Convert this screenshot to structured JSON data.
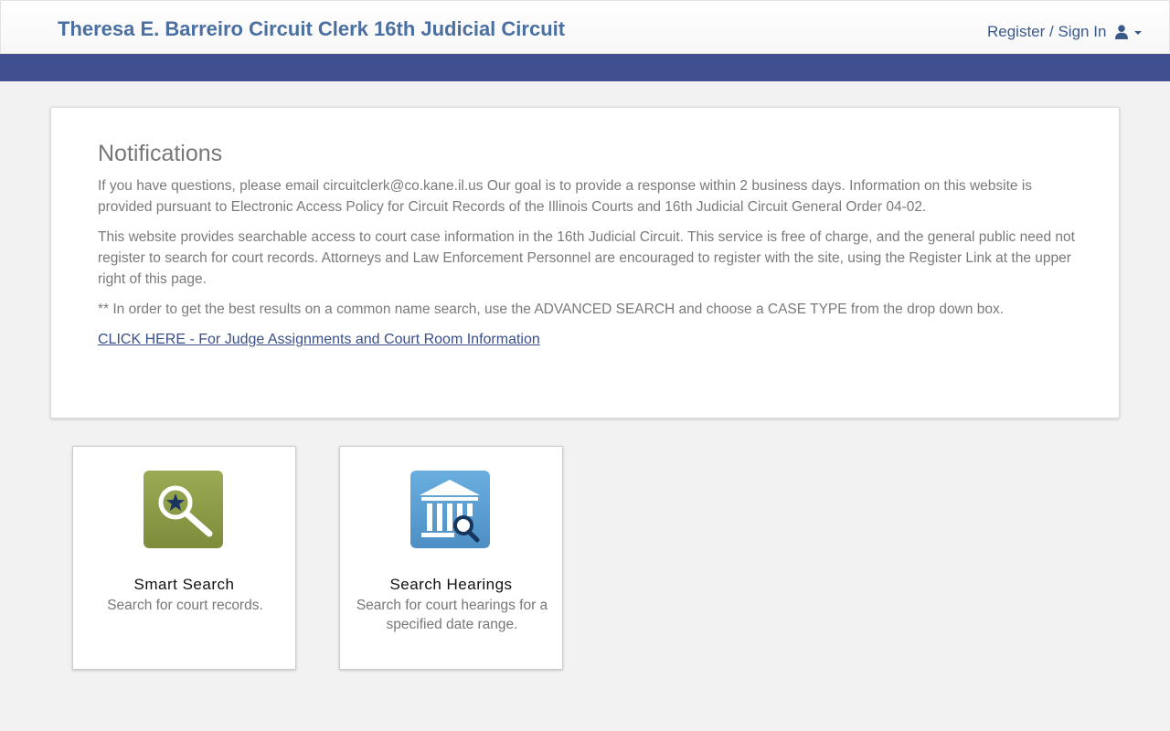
{
  "header": {
    "title": "Theresa E. Barreiro Circuit Clerk 16th Judicial Circuit",
    "signin_label": "Register / Sign In"
  },
  "notifications": {
    "heading": "Notifications",
    "paragraphs": [
      "If you have questions, please email circuitclerk@co.kane.il.us Our goal is to provide a response within 2 business days. Information on this website is provided pursuant to Electronic Access Policy for Circuit Records of the Illinois Courts and 16th Judicial Circuit General Order 04-02.",
      "This website provides searchable access to court case information in the 16th Judicial Circuit. This service is free of charge, and the general public need not register to search for court records. Attorneys and Law Enforcement Personnel are encouraged to register with the site, using the Register Link at the upper right of this page.",
      "** In order to get the best results on a common name search, use the ADVANCED SEARCH and choose a CASE TYPE from the drop down box."
    ],
    "link_text": "CLICK HERE - For Judge Assignments and Court Room Information"
  },
  "tiles": [
    {
      "title": "Smart Search",
      "description": "Search for court records.",
      "icon": "magnifier-star-icon"
    },
    {
      "title": "Search Hearings",
      "description": "Search for court hearings for a specified date range.",
      "icon": "courthouse-search-icon"
    }
  ],
  "colors": {
    "brand_blue": "#4a6fa0",
    "nav_bar": "#404f8f",
    "smart_search_green": "#8a9a44",
    "hearings_blue": "#5b9bd0"
  }
}
